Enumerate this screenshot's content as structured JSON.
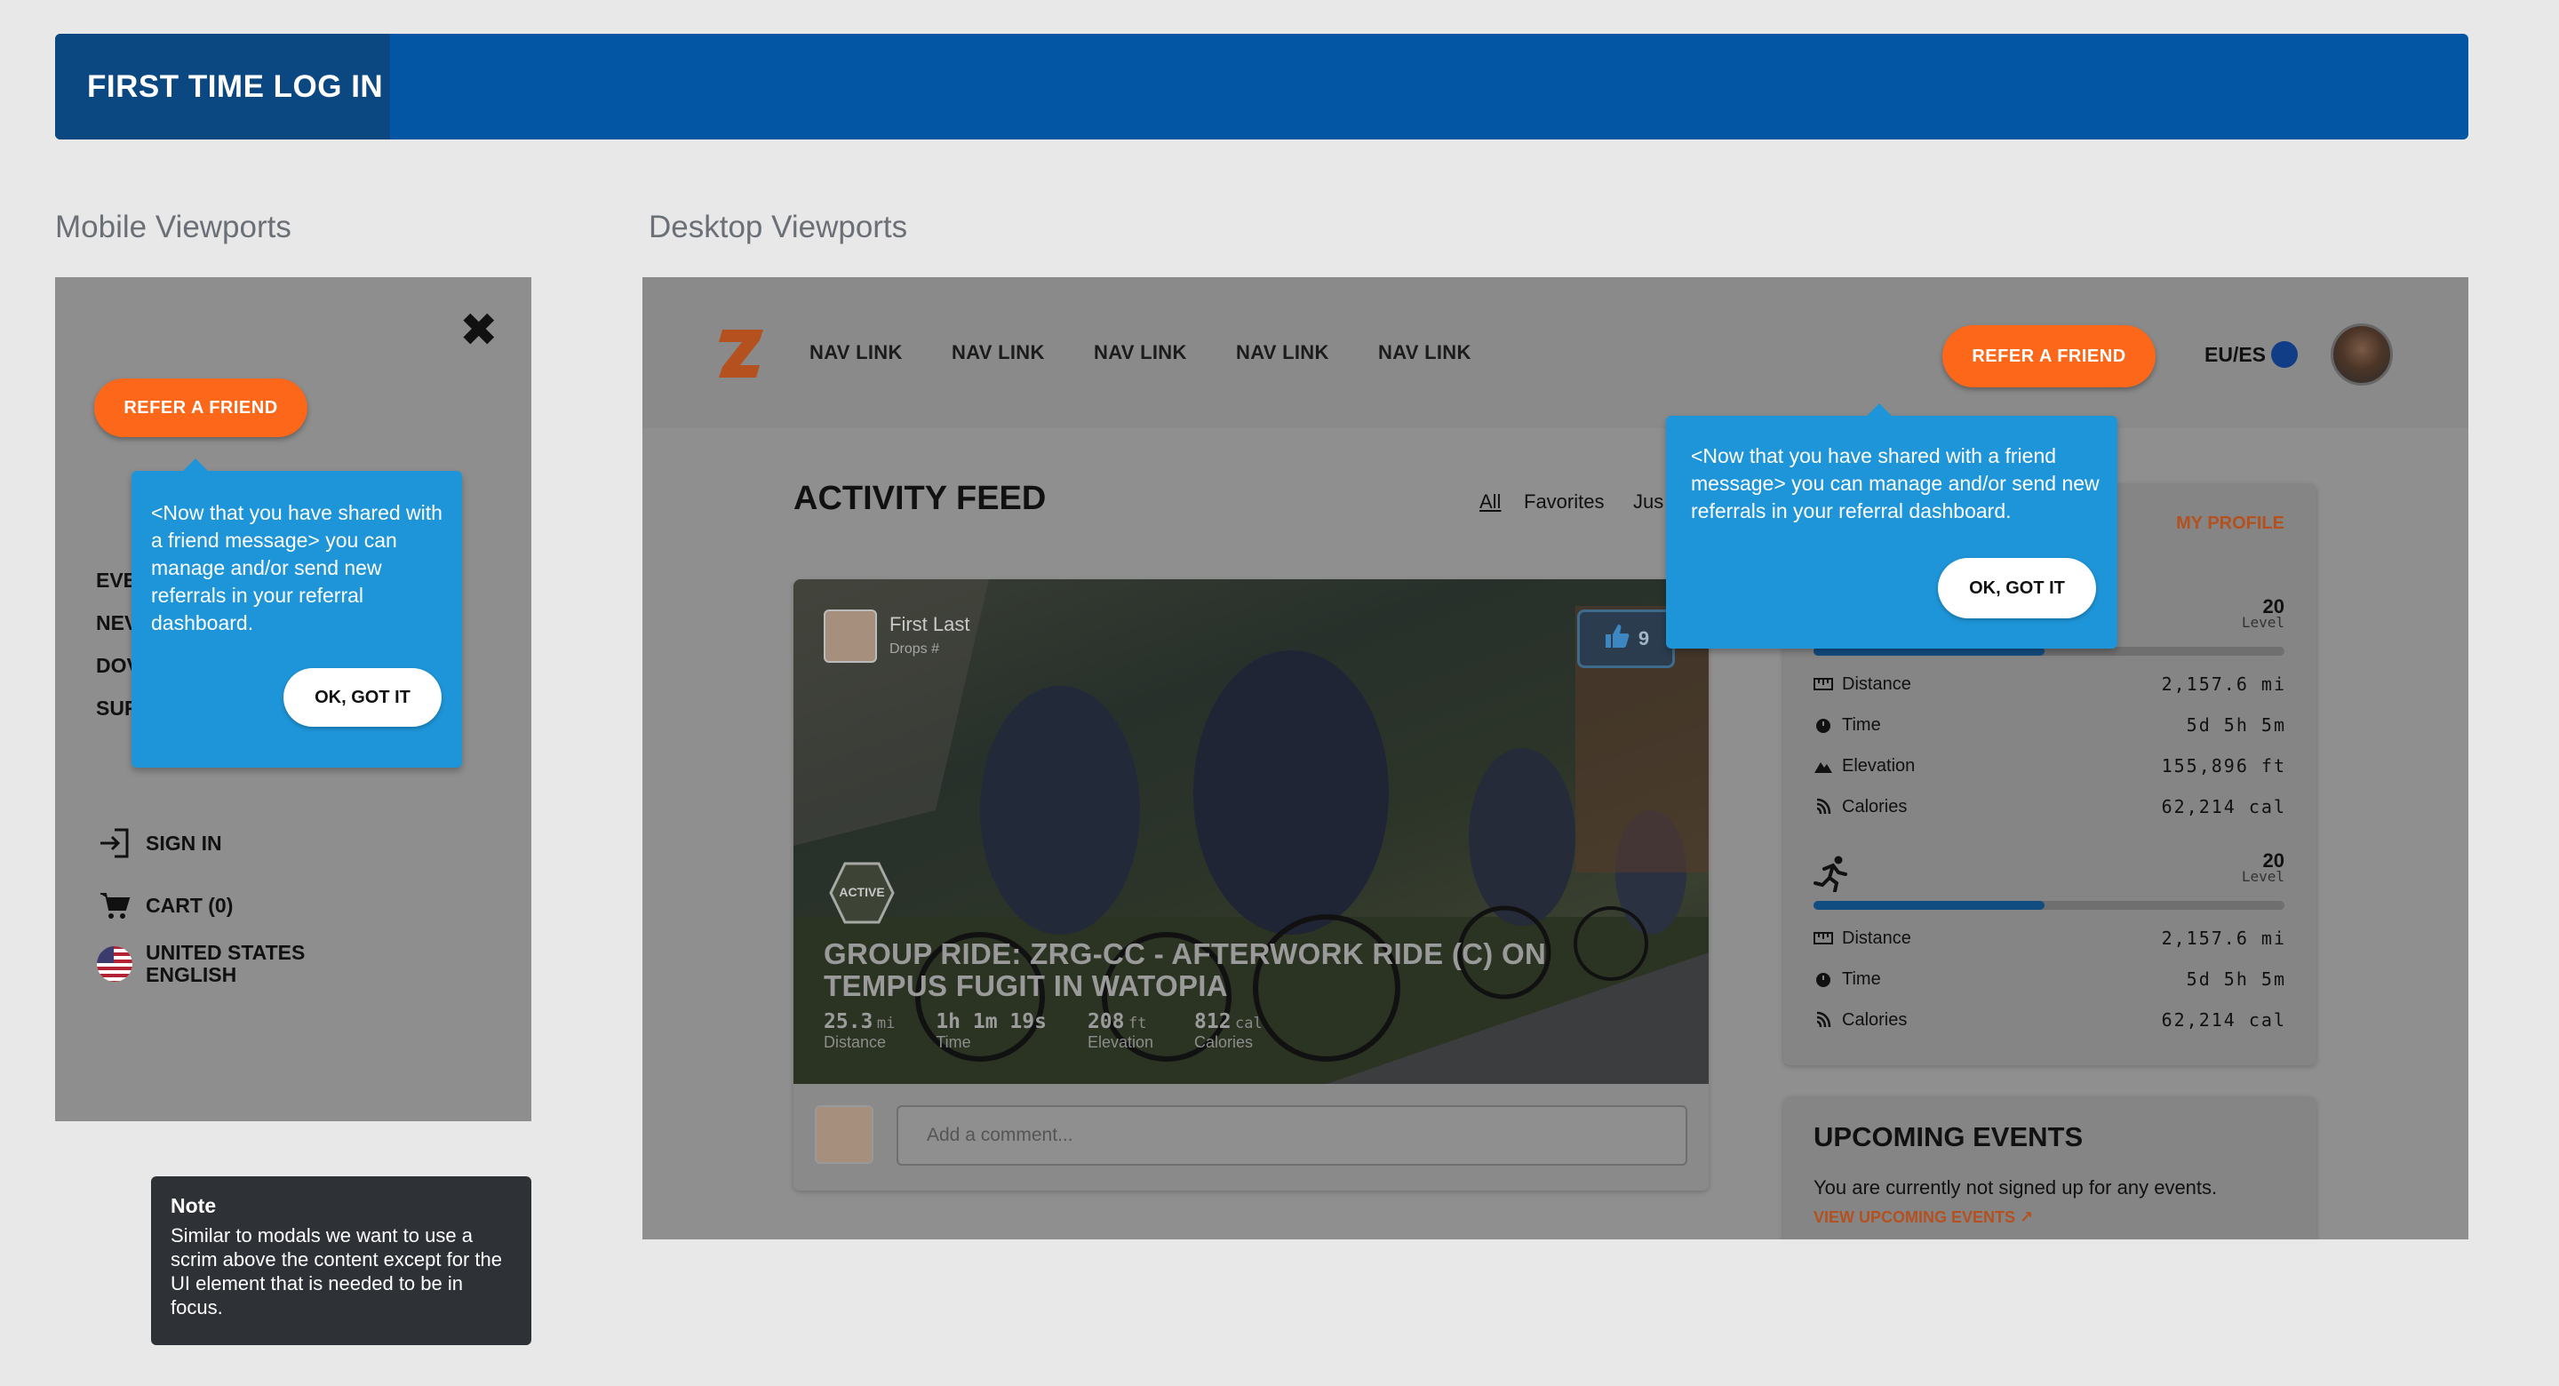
{
  "header": {
    "tab_title": "FIRST TIME LOG IN"
  },
  "sections": {
    "mobile": "Mobile Viewports",
    "desktop": "Desktop Viewports"
  },
  "colors": {
    "brand_blue": "#0356a4",
    "orange": "#fc6719",
    "tooltip_blue": "#1e95d8"
  },
  "mobile": {
    "refer_label": "REFER A FRIEND",
    "tooltip_text": "<Now that you have shared with a friend message> you can manage and/or send new referrals in your referral dashboard.",
    "ok_label": "OK, GOT IT",
    "nav_items": [
      "EVE",
      "NEV",
      "DOV",
      "SUF"
    ],
    "sign_in": "SIGN IN",
    "cart": "CART (0)",
    "country": "UNITED STATES",
    "language": "ENGLISH"
  },
  "note": {
    "title": "Note",
    "body": "Similar to modals we want to use a scrim above the content except for the UI element that is needed to be in focus."
  },
  "desktop": {
    "nav_links": [
      "NAV LINK",
      "NAV LINK",
      "NAV LINK",
      "NAV LINK",
      "NAV LINK"
    ],
    "refer_label": "REFER A FRIEND",
    "region": "EU/ES",
    "tooltip_text": "<Now that you have shared with a friend message> you can manage and/or send new referrals in your referral dashboard.",
    "ok_label": "OK, GOT IT",
    "feed_title": "ACTIVITY FEED",
    "filters": [
      "All",
      "Favorites",
      "Jus"
    ],
    "activity": {
      "user_name": "First Last",
      "user_sub": "Drops #",
      "likes": "9",
      "badge": "ACTIVE",
      "title_line1": "GROUP RIDE: ZRG-CC - AFTERWORK RIDE (C) ON",
      "title_line2": "TEMPUS FUGIT IN WATOPIA",
      "stats": [
        {
          "value": "25.3",
          "unit": "mi",
          "label": "Distance"
        },
        {
          "value": "1h 1m 19s",
          "unit": "",
          "label": "Time"
        },
        {
          "value": "208",
          "unit": "ft",
          "label": "Elevation"
        },
        {
          "value": "812",
          "unit": "cal",
          "label": "Calories"
        }
      ],
      "comment_placeholder": "Add a comment..."
    },
    "profile": {
      "link": "MY PROFILE",
      "cycling": {
        "level_num": "20",
        "level_label": "Level",
        "progress": 0.49,
        "rows": [
          {
            "icon": "distance-icon",
            "label": "Distance",
            "value": "2,157.6 mi"
          },
          {
            "icon": "time-icon",
            "label": "Time",
            "value": "5d 5h 5m"
          },
          {
            "icon": "elevation-icon",
            "label": "Elevation",
            "value": "155,896 ft"
          },
          {
            "icon": "calories-icon",
            "label": "Calories",
            "value": "62,214 cal"
          }
        ]
      },
      "running": {
        "level_num": "20",
        "level_label": "Level",
        "progress": 0.49,
        "rows": [
          {
            "icon": "distance-icon",
            "label": "Distance",
            "value": "2,157.6 mi"
          },
          {
            "icon": "time-icon",
            "label": "Time",
            "value": "5d 5h 5m"
          },
          {
            "icon": "calories-icon",
            "label": "Calories",
            "value": "62,214 cal"
          }
        ]
      }
    },
    "events": {
      "title": "UPCOMING EVENTS",
      "text": "You are currently not signed up for any events.",
      "link": "VIEW UPCOMING EVENTS ↗"
    }
  }
}
